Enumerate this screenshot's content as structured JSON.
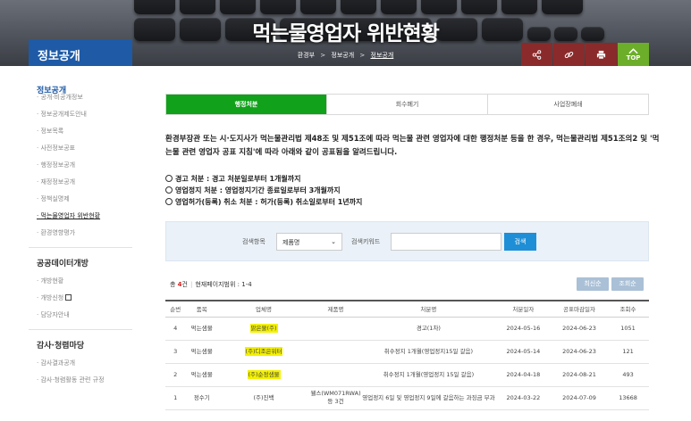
{
  "banner": {
    "title": "먹는물영업자 위반현황",
    "breadcrumb": [
      "환경부",
      "정보공개",
      "정보공개"
    ]
  },
  "section": "정보공개",
  "tools": {
    "share_icon": "share-icon",
    "link_icon": "link-icon",
    "print_icon": "print-icon",
    "top_label": "TOP"
  },
  "sidebar": {
    "group1_title": "정보공개",
    "group1_items": [
      "공개·비공개정보",
      "정보공개제도안내",
      "정보목록",
      "사전정보공표",
      "행정정보공개",
      "재정정보공개",
      "정책실명제",
      "먹는물영업자 위반현황",
      "환경영향평가"
    ],
    "group2_title": "공공데이터개방",
    "group2_items": [
      "개방현황",
      "개방신청",
      "담당자안내"
    ],
    "group3_title": "감사·청렴마당",
    "group3_items": [
      "감사결과공개",
      "감사·청렴활동 관련 규정"
    ]
  },
  "tabs": [
    "행정처분",
    "회수폐기",
    "사업장폐쇄"
  ],
  "description": "환경부장관 또는 시·도지사가 먹는물관리법 제48조 및 제51조에 따라 먹는물 관련 영업자에 대한 행정처분 등을 한 경우, 먹는물관리법 제51조의2 및 '먹는물 관련 영업자 공표 지침'에 따라 아래와 같이 공표됨을 알려드립니다.",
  "rules": [
    "경고 처분 : 경고 처분일로부터 1개월까지",
    "영업정지 처분 : 영업정지기간 종료일로부터 3개월까지",
    "영업허가(등록) 취소 처분 : 허가(등록) 취소일로부터 1년까지"
  ],
  "search": {
    "field_label": "검색항목",
    "field_value": "제품명",
    "keyword_label": "검색키워드",
    "keyword_value": "",
    "button": "검색"
  },
  "summary": {
    "total_prefix": "총 ",
    "total_count": "4",
    "total_suffix": "건",
    "range": "현재페이지범위 : 1-4"
  },
  "sort_buttons": [
    "최신순",
    "조회순"
  ],
  "table": {
    "headers": [
      "순번",
      "품목",
      "업체명",
      "제품명",
      "처분명",
      "처분일자",
      "공표마감일자",
      "조회수"
    ],
    "rows": [
      [
        "4",
        "먹는샘물",
        "맑은물(주)",
        "",
        "경고(1차)",
        "2024-05-16",
        "2024-06-23",
        "1051"
      ],
      [
        "3",
        "먹는샘물",
        "(주)디조은워터",
        "",
        "취수정지 1개월(영업정지15일 갈음)",
        "2024-05-14",
        "2024-06-23",
        "121"
      ],
      [
        "2",
        "먹는샘물",
        "(주)순정샘물",
        "",
        "취수정지 1개월(영업정지 15일 갈음)",
        "2024-04-18",
        "2024-08-21",
        "493"
      ],
      [
        "1",
        "정수기",
        "(주)진백",
        "웰스(WM071RWA) 등 3건",
        "영업정지 6일 및 영업정지 9일에 갈음하는 과징금 부과",
        "2024-03-22",
        "2024-07-09",
        "13668"
      ]
    ],
    "highlighted_companies": [
      true,
      true,
      true,
      false
    ]
  },
  "colors": {
    "tab_active": "#11a11b",
    "section_blue": "#1e5aa6",
    "tool_red": "#8b2a2a",
    "top_green": "#6cae2a",
    "search_button": "#1e8fd6",
    "highlight": "#f4f100"
  }
}
